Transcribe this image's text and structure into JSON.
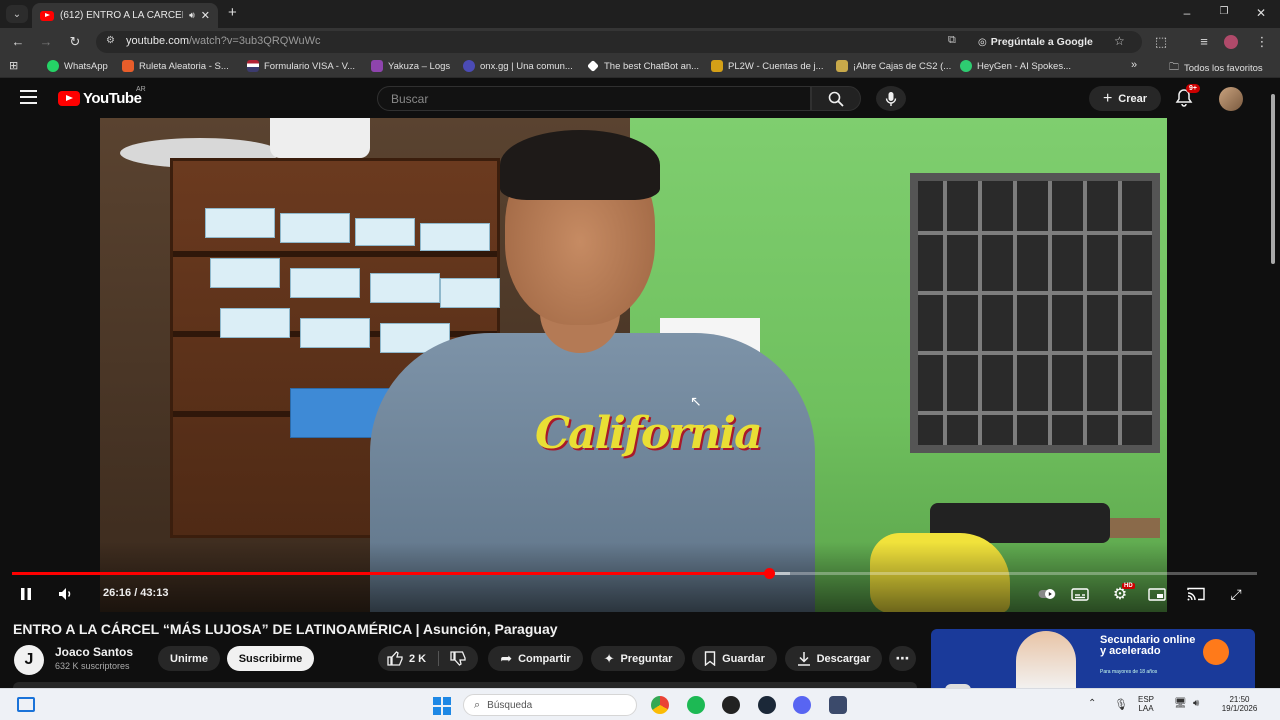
{
  "browser": {
    "tab_title": "(612) ENTRO A LA CÁRCEL",
    "url_host": "youtube.com",
    "url_path": "/watch?v=3ub3QRQWuWc",
    "ask_google": "Pregúntale a Google",
    "bookmarks": [
      {
        "label": "WhatsApp",
        "color": "#25d366"
      },
      {
        "label": "Ruleta Aleatoria - S...",
        "color": "#e85d2a"
      },
      {
        "label": "Formulario VISA - V...",
        "color": "#3b5bdb"
      },
      {
        "label": "Yakuza – Logs",
        "color": "#8e44ad"
      },
      {
        "label": "onx.gg | Una comun...",
        "color": "#4b4bb5"
      },
      {
        "label": "The best ChatBot an...",
        "color": "#ffffff"
      },
      {
        "label": "PL2W - Cuentas de j...",
        "color": "#d4a017"
      },
      {
        "label": "¡Abre Cajas de CS2 (...",
        "color": "#c8a94a"
      },
      {
        "label": "HeyGen - AI Spokes...",
        "color": "#2ecc71"
      }
    ],
    "all_favorites": "Todos los favoritos"
  },
  "youtube": {
    "logo_text": "YouTube",
    "region": "AR",
    "search_placeholder": "Buscar",
    "create_label": "Crear",
    "notif_badge": "9+"
  },
  "player": {
    "current_time": "26:16",
    "duration": "43:13",
    "time_display": "26:16 / 43:13",
    "played_fraction": 0.608,
    "buffered_fraction": 0.625,
    "hd_badge": "HD",
    "shirt_text": "California"
  },
  "video": {
    "title": "ENTRO A LA CÁRCEL “MÁS LUJOSA” DE LATINOAMÉRICA | Asunción, Paraguay",
    "channel_initial": "J",
    "channel_name": "Joaco Santos",
    "subscribers": "632 K suscriptores",
    "join_label": "Unirme",
    "subscribe_label": "Suscribirme",
    "likes": "2 K",
    "share_label": "Compartir",
    "ask_label": "Preguntar",
    "save_label": "Guardar",
    "download_label": "Descargar"
  },
  "ad": {
    "headline": "Secundario online y acelerado",
    "fine_print": "Para mayores de 18 años"
  },
  "taskbar": {
    "search_placeholder": "Búsqueda",
    "lang_top": "ESP",
    "lang_bottom": "LAA",
    "time": "21:50",
    "date": "19/1/2026"
  }
}
